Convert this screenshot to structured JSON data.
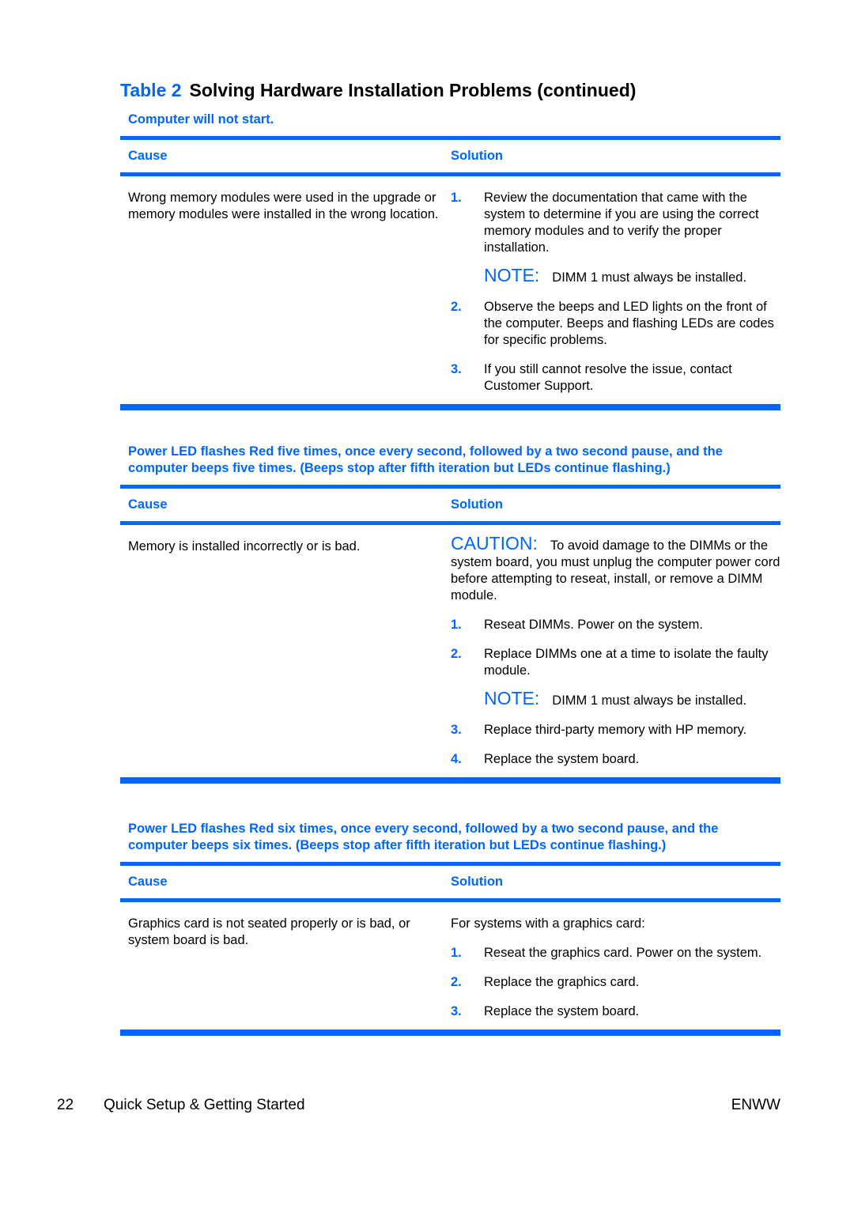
{
  "title": {
    "table_number": "Table 2",
    "text": "Solving Hardware Installation Problems (continued)"
  },
  "columns": {
    "cause": "Cause",
    "solution": "Solution"
  },
  "sections": [
    {
      "heading": "Computer will not start.",
      "cause": "Wrong memory modules were used in the upgrade or memory modules were installed in the wrong location.",
      "steps": [
        {
          "num": "1.",
          "text": "Review the documentation that came with the system to determine if you are using the correct memory modules and to verify the proper installation."
        },
        {
          "num": "2.",
          "text": "Observe the beeps and LED lights on the front of the computer. Beeps and flashing LEDs are codes for specific problems."
        },
        {
          "num": "3.",
          "text": "If you still cannot resolve the issue, contact Customer Support."
        }
      ],
      "note": {
        "label": "NOTE:",
        "text": "DIMM 1 must always be installed."
      }
    },
    {
      "heading": "Power LED flashes Red five times, once every second, followed by a two second pause, and the computer beeps five times. (Beeps stop after fifth iteration but LEDs continue flashing.)",
      "cause": "Memory is installed incorrectly or is bad.",
      "caution": {
        "label": "CAUTION:",
        "text": "To avoid damage to the DIMMs or the system board, you must unplug the computer power cord before attempting to reseat, install, or remove a DIMM module."
      },
      "steps": [
        {
          "num": "1.",
          "text": "Reseat DIMMs. Power on the system."
        },
        {
          "num": "2.",
          "text": "Replace DIMMs one at a time to isolate the faulty module."
        },
        {
          "num": "3.",
          "text": "Replace third-party memory with HP memory."
        },
        {
          "num": "4.",
          "text": "Replace the system board."
        }
      ],
      "note": {
        "label": "NOTE:",
        "text": "DIMM 1 must always be installed."
      }
    },
    {
      "heading": "Power LED flashes Red six times, once every second, followed by a two second pause, and the computer beeps six times. (Beeps stop after fifth iteration but LEDs continue flashing.)",
      "cause": "Graphics card is not seated properly or is bad, or system board is bad.",
      "intro": "For systems with a graphics card:",
      "steps": [
        {
          "num": "1.",
          "text": "Reseat the graphics card. Power on the system."
        },
        {
          "num": "2.",
          "text": "Replace the graphics card."
        },
        {
          "num": "3.",
          "text": "Replace the system board."
        }
      ]
    }
  ],
  "footer": {
    "page_number": "22",
    "book_title": "Quick Setup & Getting Started",
    "locale": "ENWW"
  },
  "colors": {
    "accent": "#0066ff"
  }
}
